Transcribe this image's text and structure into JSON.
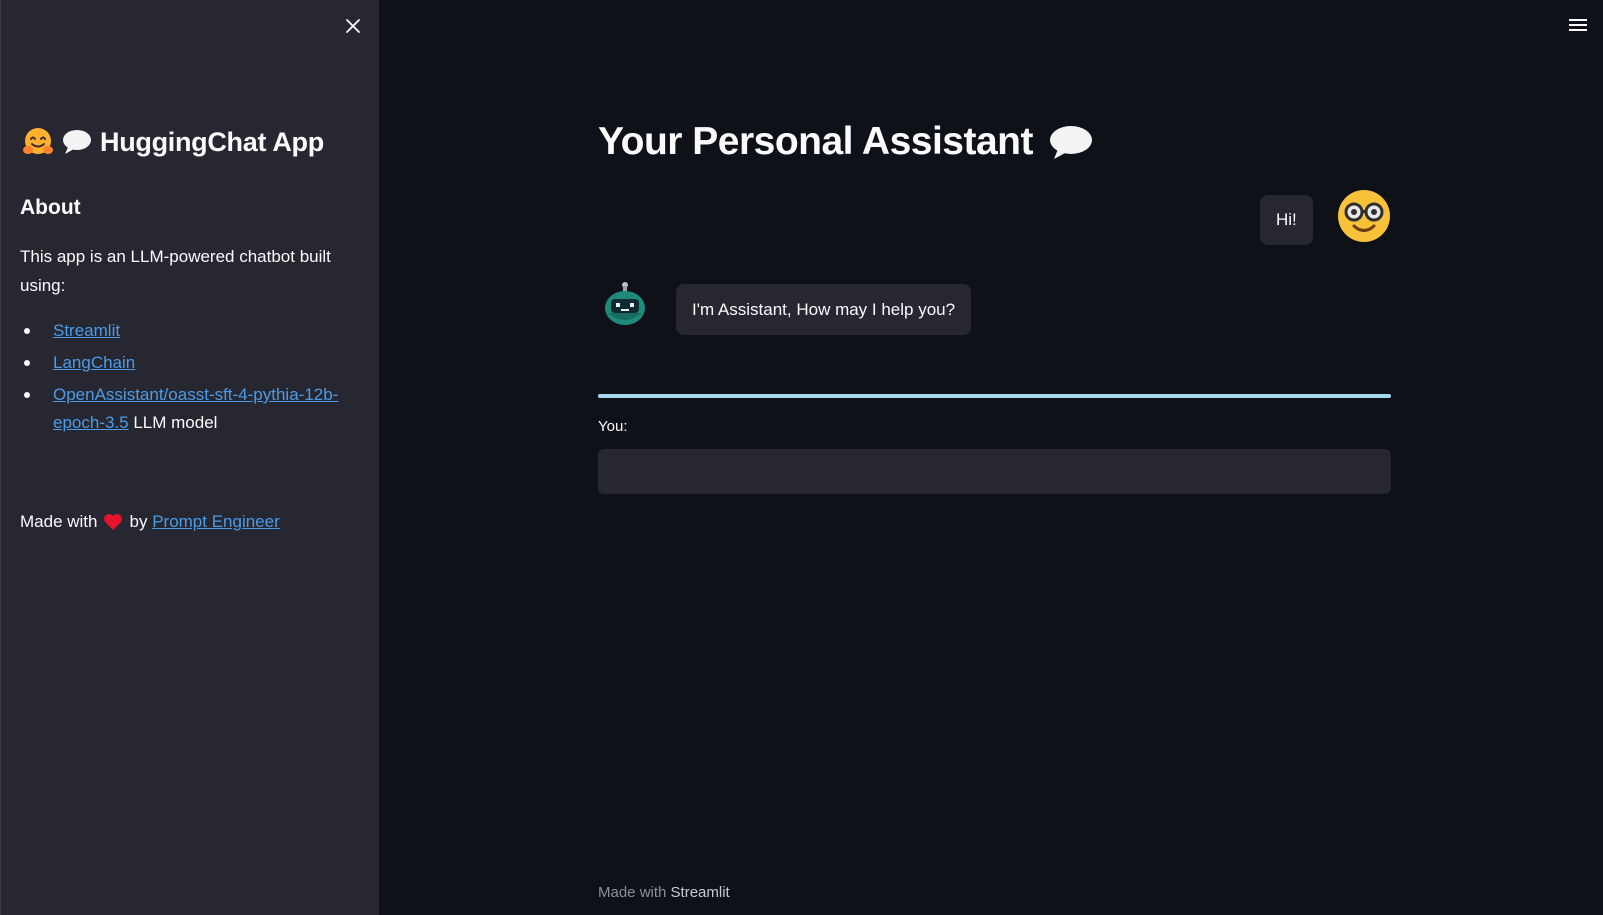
{
  "sidebar": {
    "title": "HuggingChat App",
    "title_icons": [
      "hugging-face-icon",
      "speech-bubble-icon"
    ],
    "about_heading": "About",
    "about_text": "This app is an LLM-powered chatbot built using:",
    "links": [
      {
        "label": "Streamlit",
        "suffix": ""
      },
      {
        "label": "LangChain",
        "suffix": ""
      },
      {
        "label": "OpenAssistant/oasst-sft-4-pythia-12b-epoch-3.5",
        "suffix": " LLM model"
      }
    ],
    "made_with_prefix": "Made with",
    "made_with_by": "by",
    "made_with_author": "Prompt Engineer"
  },
  "main": {
    "title": "Your Personal Assistant",
    "title_icon": "speech-bubble-icon",
    "messages": [
      {
        "role": "user",
        "text": "Hi!",
        "avatar": "nerd-face-avatar"
      },
      {
        "role": "assistant",
        "text": "I'm Assistant, How may I help you?",
        "avatar": "robot-avatar"
      }
    ],
    "input_label": "You:",
    "input_value": "",
    "input_placeholder": ""
  },
  "footer": {
    "prefix": "Made with",
    "brand": "Streamlit"
  },
  "colors": {
    "background": "#0e1117",
    "sidebar": "#262730",
    "link": "#4c9be8",
    "divider": "#a8d8f0"
  }
}
